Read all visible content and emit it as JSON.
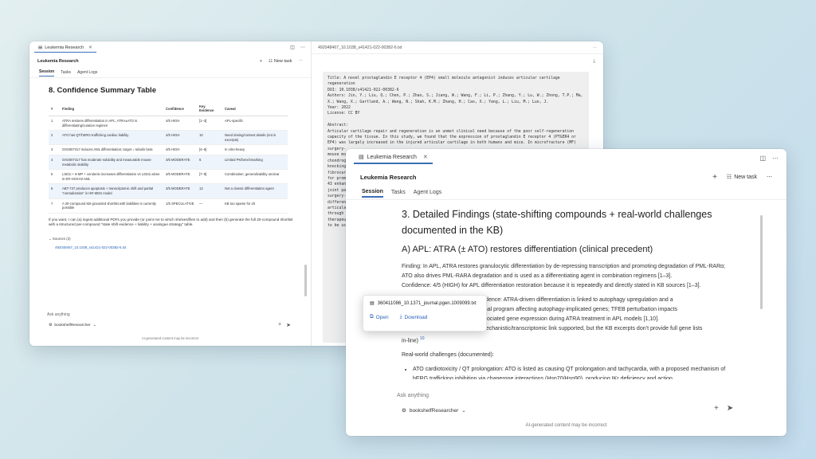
{
  "app_title": "Leukemia Research",
  "back": {
    "tab_label": "Leukemia Research",
    "header_title": "Leukemia Research",
    "new_task_label": "New task",
    "tabs": [
      "Session",
      "Tasks",
      "Agent Logs"
    ],
    "section_title": "8. Confidence Summary Table",
    "table": {
      "headers": [
        "#",
        "Finding",
        "Confidence",
        "Key Evidence",
        "Caveat"
      ],
      "rows": [
        [
          "1",
          "ATRA restores differentiation in APL; ATRA±ATO is differentiating/curative regimen",
          "4/5 HIGH",
          "[1–3]",
          "APL-specific"
        ],
        [
          "2",
          "ATO has QT/hERG-trafficking cardiac liability",
          "4/5 HIGH",
          "10",
          "Need dosing/context details (not in excerpts)"
        ],
        [
          "3",
          "OXS007417 induces AML differentiation; target = tubulin beta",
          "4/5 HIGH",
          "[4–6]",
          "In vitro-heavy"
        ],
        [
          "4",
          "OXS007417 has moderate solubility and measurable mouse metabolic stability",
          "3/5 MODERATE",
          "6",
          "Limited PK/benchmarking"
        ],
        [
          "5",
          "LSD1i + 6-MP + cerulenin increases differentiation vs LSD1i alone in ER-HOXA9 AML",
          "3/5 MODERATE",
          "[7–9]",
          "Combination; generalizability unclear"
        ],
        [
          "6",
          "ABT-737 produces apoptosis + transcriptomic shift and partial “normalization” in HR-MDS model",
          "3/5 MODERATE",
          "12",
          "Not a classic differentiation agent"
        ],
        [
          "7",
          "A 20-compound KB-grounded shortlist with liabilities is currently possible",
          "1/5 SPECULATIVE",
          "—",
          "KB too sparse for 20"
        ]
      ]
    },
    "paragraph": "If you want, I can (a) ingest additional PDFs you provide (or point me to which shelves/files to add) and then (b) generate the full 20-compound shortlist with a structured per-compound “state shift evidence + liability + analogue strategy” table.",
    "sources_label": "Sources (2)",
    "source_link": "492048467_10.1038_s41421-022-00382-6.txt",
    "ask_placeholder": "Ask anything",
    "agent_name": "bookshelfResearcher",
    "footer": "AI-generated content may be incorrect",
    "file_tab": "492048467_10.1038_s41421-022-00382-6.txt",
    "file_text": "Title: A novel prostaglandin E receptor 4 (EP4) small molecule antagonist induces articular cartilage regeneration\nDOI: 10.1038/s41421-022-00382-6\nAuthors: Jin, Y.; Liu, Q.; Chen, P.; Zhao, S.; Jiang, W.; Wang, F.; Li, P.; Zhang, Y.; Lu, W.; Zhong, T.P.; Ma, X.; Wang, X.; Gartland, A.; Wang, N.; Shah, K.M.; Zhang, H.; Cao, X.; Yang, L.; Liu, M.; Luo, J.\nYear: 2022\nLicense: CC BY\n\nAbstract:\nArticular cartilage repair and regeneration is an unmet clinical need because of the poor self-regeneration capacity of the tissue. In this study, we found that the expression of prostaglandin E receptor 4 (PTGER4 or EP4) was largely increased in the injured articular cartilage in both humans and mice. In microfracture (MF) surgery-\nmouse mo\nchondrog\nknocking\nfibrocar\nfor prom\n43 enhan\njoint pa\nsurgery-\ndifferen\narticula\nthrough \ntherapeu\nto be us"
  },
  "front": {
    "tab_label": "Leukemia Research",
    "header_title": "Leukemia Research",
    "new_task_label": "New task",
    "tabs": [
      "Session",
      "Tasks",
      "Agent Logs"
    ],
    "heading": "3. Detailed Findings (state-shifting compounds + real-world challenges documented in the KB)",
    "subheading": "A) APL: ATRA (± ATO) restores differentiation (clinical precedent)",
    "finding": "Finding: In APL, ATRA restores granulocytic differentiation by de-repressing transcription and promoting degradation of PML-RARα; ATO also drives PML-RARA degradation and is used as a differentiating agent in combination regimens [1–3].",
    "confidence": "Confidence: 4/5 (HIGH) for APL differentiation restoration because it is repeatedly and directly stated in KB sources [1–3].",
    "mech_1": "vidence: ATRA-driven differentiation is linked to autophagy upregulation and a",
    "mech_2": "onal program affecting autophagy-implicated genes; TFEB perturbation impacts",
    "mech_3": "ssociated gene expression during ATRA treatment in APL models [1,10].",
    "mech_4": "mechanistic/transcriptomic link supported, but the KB excerpts don’t provide full gene lists",
    "mech_5": "in-line)",
    "cite_10": "10",
    "challenges_label": "Real-world challenges (documented):",
    "bullet_1": "ATO cardiotoxicity / QT prolongation: ATO is listed as causing QT prolongation and tachycardia, with a proposed mechanism of hERG trafficking inhibition via chaperone interactions (Hsp70/Hsp90), producing IKr deficiency and action",
    "ask_placeholder": "Ask anything",
    "agent_name": "bookshelfResearcher",
    "footer": "AI-generated content may be incorrect"
  },
  "popup": {
    "filename": "360411086_10.1371_journal.pgen.1009099.txt",
    "open_label": "Open",
    "download_label": "Download"
  },
  "colors": {
    "accent": "#3b6fb6",
    "link": "#2a63b8",
    "row_alt": "#eef4fb"
  }
}
